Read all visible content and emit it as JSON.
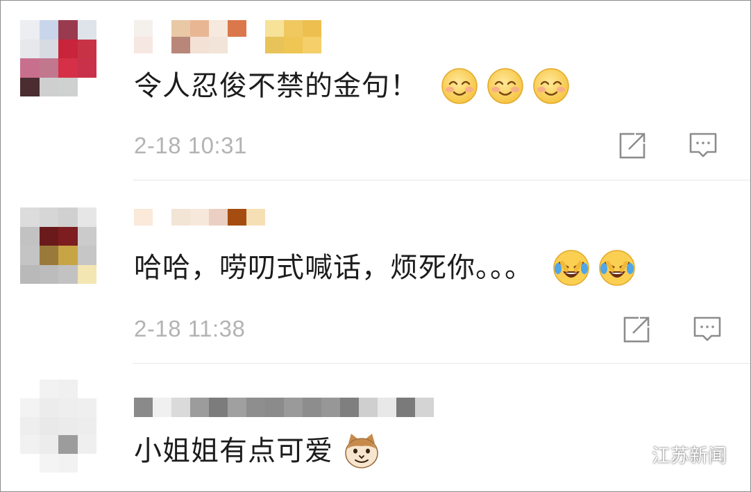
{
  "comments": [
    {
      "text": "令人忍俊不禁的金句！",
      "time": "2-18 10:31",
      "emojis": [
        "smile-emoji",
        "smile-emoji",
        "smile-emoji"
      ]
    },
    {
      "text": "哈哈，唠叨式喊话，烦死你。。。",
      "time": "2-18 11:38",
      "emojis": [
        "laugh-cry-emoji",
        "laugh-cry-emoji"
      ]
    },
    {
      "text": "小姐姐有点可爱",
      "emojis": [
        "cat-emoji"
      ]
    }
  ],
  "actions": {
    "share_icon": "share-icon",
    "reply_icon": "comment-icon"
  },
  "watermark": {
    "text": "江苏新闻",
    "icon": "wechat-icon"
  },
  "colors": {
    "timestamp": "#b3b3b3",
    "text": "#1c1c1c",
    "divider": "#e6e6e6",
    "emoji_face": "#fcd86a"
  }
}
